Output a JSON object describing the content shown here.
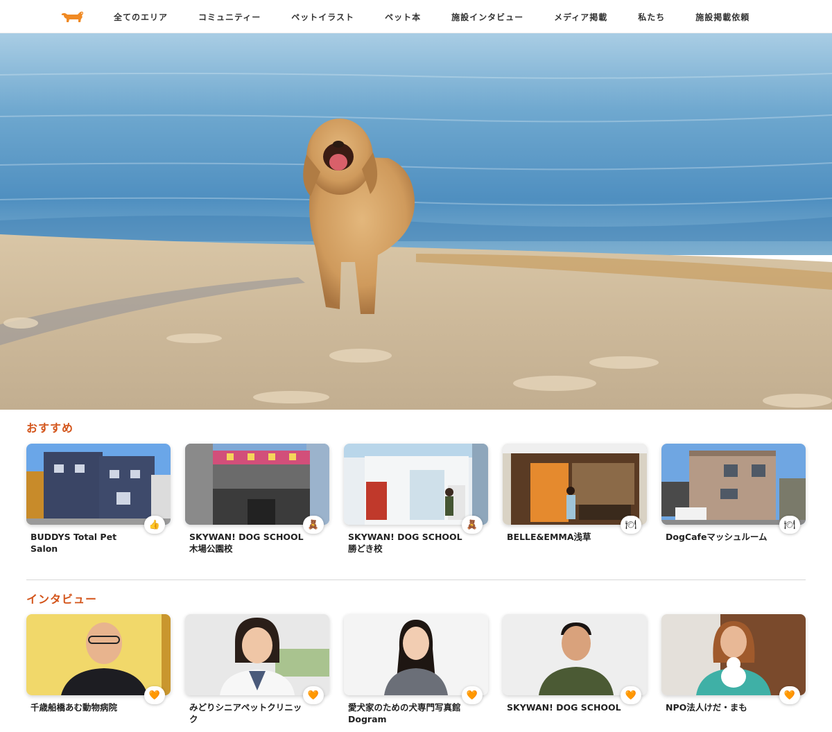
{
  "nav": {
    "logo": "dog-logo-icon",
    "items": [
      "全てのエリア",
      "コミュニティー",
      "ペットイラスト",
      "ペット本",
      "施設インタビュー",
      "メディア掲載",
      "私たち",
      "施設掲載依頼"
    ]
  },
  "hero": {
    "image": "golden-retriever-running-on-beach"
  },
  "recommend": {
    "title": "おすすめ",
    "cards": [
      {
        "title": "BUDDYS Total Pet Salon",
        "badge": "👍",
        "badge_icon": "thumbs-up-icon"
      },
      {
        "title": "SKYWAN! DOG SCHOOL 木場公園校",
        "badge": "🧸",
        "badge_icon": "teddy-bear-icon"
      },
      {
        "title": "SKYWAN! DOG SCHOOL 勝どき校",
        "badge": "🧸",
        "badge_icon": "teddy-bear-icon"
      },
      {
        "title": "BELLE&EMMA浅草",
        "badge": "🍽",
        "badge_icon": "plate-icon"
      },
      {
        "title": "DogCafeマッシュルーム",
        "badge": "🍽",
        "badge_icon": "plate-icon"
      }
    ]
  },
  "interview": {
    "title": "インタビュー",
    "cards": [
      {
        "title": "千歳船橋あむ動物病院",
        "badge": "🧡",
        "badge_icon": "heart-icon"
      },
      {
        "title": "みどりシニアペットクリニック",
        "badge": "🧡",
        "badge_icon": "heart-icon"
      },
      {
        "title": "愛犬家のための犬専門写真館 Dogram",
        "badge": "🧡",
        "badge_icon": "heart-icon"
      },
      {
        "title": "SKYWAN! DOG SCHOOL",
        "badge": "🧡",
        "badge_icon": "heart-icon"
      },
      {
        "title": "NPO法人けだ・まも",
        "badge": "🧡",
        "badge_icon": "heart-icon"
      }
    ]
  },
  "colors": {
    "accent": "#d3541a",
    "logo": "#f08a24"
  }
}
